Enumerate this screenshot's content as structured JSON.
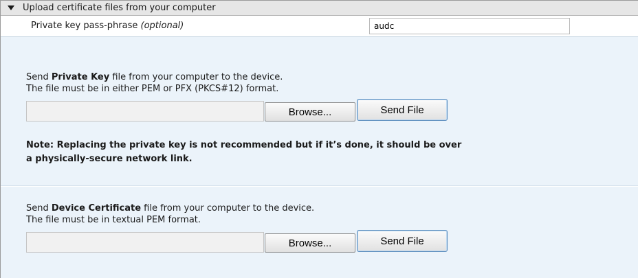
{
  "section": {
    "title": "Upload certificate files from your computer"
  },
  "passphrase": {
    "label": "Private key pass-phrase ",
    "optional": "(optional)",
    "value": "audc"
  },
  "private_key": {
    "line1_prefix": "Send ",
    "line1_bold": "Private Key",
    "line1_suffix": " file from your computer to the device.",
    "line2": "The file must be in either PEM or PFX (PKCS#12) format.",
    "browse_label": "Browse...",
    "send_label": "Send File",
    "note_line1": "Note: Replacing the private key is not recommended but if it’s done, it should be over",
    "note_line2": "a physically-secure network link."
  },
  "device_cert": {
    "line1_prefix": "Send ",
    "line1_bold": "Device Certificate",
    "line1_suffix": " file from your computer to the device.",
    "line2": "The file must be in textual PEM format.",
    "browse_label": "Browse...",
    "send_label": "Send File"
  }
}
